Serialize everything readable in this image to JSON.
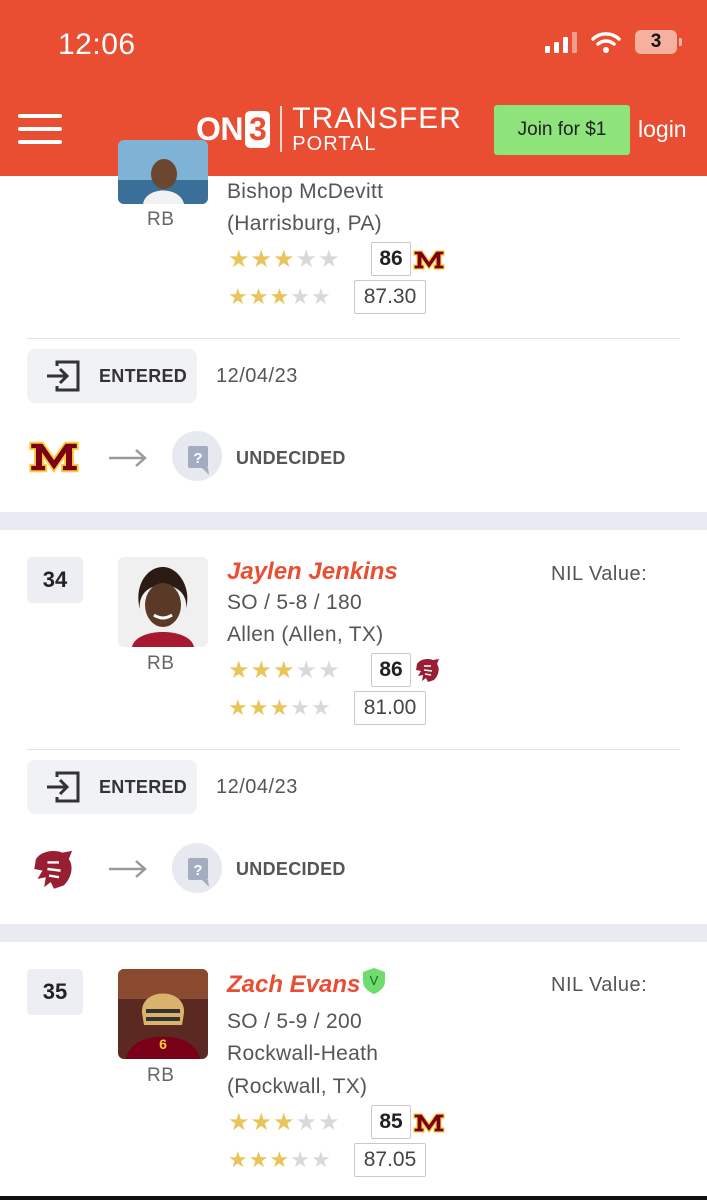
{
  "status_bar": {
    "time": "12:06",
    "battery": "3"
  },
  "header": {
    "logo_on": "ON",
    "logo_3": "3",
    "logo_transfer": "TRANSFER",
    "logo_portal": "PORTAL",
    "join_label": "Join for $1",
    "login_label": "login"
  },
  "colors": {
    "brand": "#e94e33",
    "join_button": "#8ee37a",
    "star_on": "#e9c45a",
    "star_off": "#d9d9d9",
    "minnesota": "#7a0019",
    "wsu": "#981e32"
  },
  "players": [
    {
      "school_line1": "Bishop McDevitt",
      "school_line2": "(Harrisburg, PA)",
      "position": "RB",
      "on3_stars": 3,
      "on3_rating": "86",
      "team_logo": "minnesota-m-icon",
      "consensus_stars": 3,
      "consensus_rating": "87.30",
      "status": "ENTERED",
      "date": "12/04/23",
      "destination": "UNDECIDED"
    },
    {
      "rank": "34",
      "name": "Jaylen Jenkins",
      "class_size": "SO / 5-8 / 180",
      "school_line1": "Allen (Allen, TX)",
      "position": "RB",
      "nil_label": "NIL Value:",
      "on3_stars": 3,
      "on3_rating": "86",
      "team_logo": "wsu-cougar-icon",
      "consensus_stars": 3,
      "consensus_rating": "81.00",
      "status": "ENTERED",
      "date": "12/04/23",
      "destination": "UNDECIDED"
    },
    {
      "rank": "35",
      "name": "Zach Evans",
      "verified": "V",
      "class_size": "SO / 5-9 / 200",
      "school_line1": "Rockwall-Heath",
      "school_line2": "(Rockwall, TX)",
      "position": "RB",
      "nil_label": "NIL Value:",
      "on3_stars": 3,
      "on3_rating": "85",
      "team_logo": "minnesota-m-icon",
      "consensus_stars": 3,
      "consensus_rating": "87.05"
    }
  ]
}
